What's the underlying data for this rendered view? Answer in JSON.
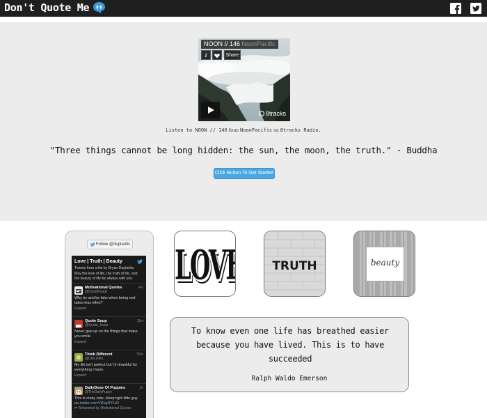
{
  "header": {
    "title": "Don't Quote Me",
    "icons": [
      "speech-bubble-icon",
      "facebook-icon",
      "twitter-icon"
    ]
  },
  "player": {
    "track_title": "NOON // 146",
    "track_artist": "NoonPacific",
    "info_label": "i",
    "share_label": "Share",
    "logo_text": "8tracks"
  },
  "listen": {
    "prefix": "Listen to ",
    "track": "NOON // 146",
    "from_word": " from ",
    "artist": "NoonPacific",
    "on_word": " on ",
    "station": "8tracks Radio",
    "suffix": "."
  },
  "hero": {
    "quote": "\"Three things cannot be long hidden: the sun, the moon, the truth.\" - Buddha",
    "cta_label": "Click Button To Get Started"
  },
  "twitter_widget": {
    "follow_label": "Follow @duplantis",
    "timeline_title": "Love | Truth | Beauty",
    "timeline_subtitle": "Tweets from a list by Bryan Duplantis",
    "timeline_description": "May the love of life, the truth of life, and the beauty of life be always with you.",
    "tweets": [
      {
        "name": "Motivational Quotes",
        "handle": "@DavidRoads",
        "time": "4m",
        "text": "Why try and be fake when being real takes less effort?",
        "expand": "Expand",
        "avatar_color": "#e8e8e8"
      },
      {
        "name": "Quote Soup",
        "handle": "@Quote_Soup",
        "time": "11m",
        "text": "Never give up on the things that make you smile.",
        "expand": "Expand",
        "avatar_color": "#c0392b"
      },
      {
        "name": "Think Different",
        "handle": "@LifeLimits",
        "time": "15m",
        "text": "My life isn't perfect but I'm thankful for everything I have.",
        "expand": "Expand",
        "avatar_color": "#8db04a"
      },
      {
        "name": "DailyDose Of Puppies",
        "handle": "@TheDailyPuppy",
        "time": "1h",
        "text": "This is crazy cute, sleep tight little guy.",
        "link": "pic.twitter.com/Vt1kgDY1xD",
        "retweet": "Retweeted by Motivational Quotes",
        "avatar_color": "#b59a78"
      }
    ]
  },
  "tiles": {
    "love": "LOVE",
    "truth": "TRUTH",
    "beauty": "beauty"
  },
  "quote_card": {
    "text": "To know even one life has breathed easier because you have lived. This is to have succeeded",
    "author": "Ralph Waldo Emerson"
  },
  "colors": {
    "topbar": "#1f1f1f",
    "hero_bg": "#ececec",
    "accent": "#4aa7e3",
    "bubble": "#3a9ad9"
  }
}
